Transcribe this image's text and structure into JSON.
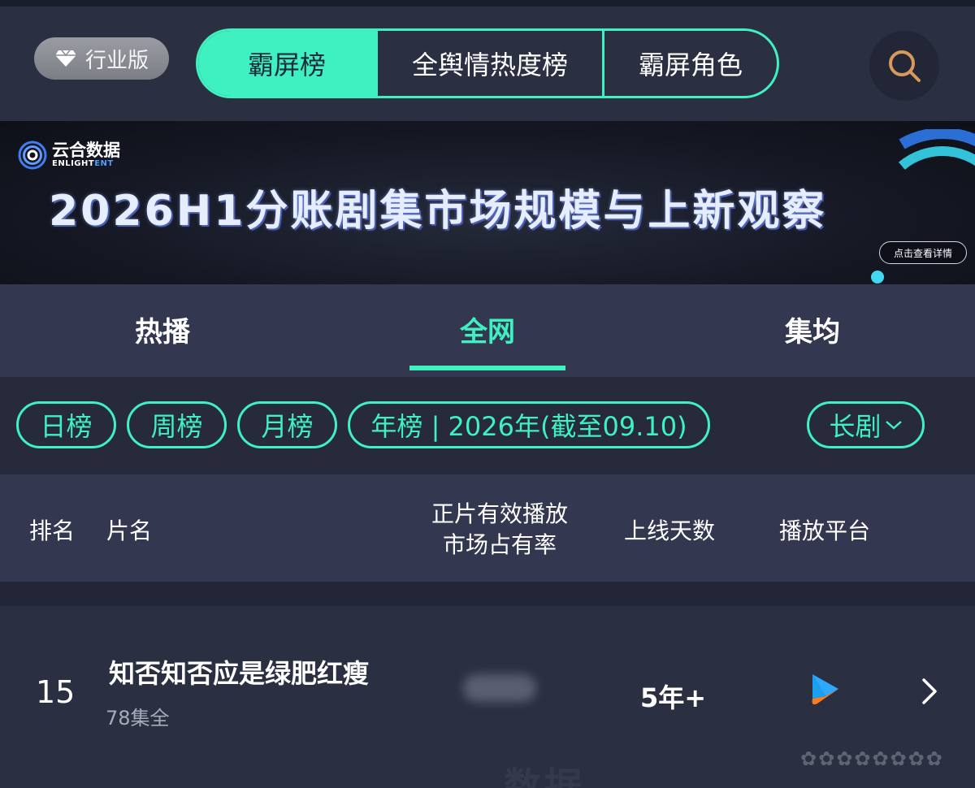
{
  "header": {
    "edition_badge": "行业版",
    "tabs": [
      {
        "label": "霸屏榜",
        "active": true
      },
      {
        "label": "全舆情热度榜",
        "active": false
      },
      {
        "label": "霸屏角色",
        "active": false
      }
    ],
    "search_icon": "search-icon"
  },
  "banner": {
    "logo_cn": "云合数据",
    "logo_en_part1": "ENLIGHT",
    "logo_en_part2": "ENT",
    "title": "2026H1分账剧集市场规模与上新观察",
    "detail_button": "点击查看详情"
  },
  "category_tabs": [
    {
      "label": "热播",
      "active": false
    },
    {
      "label": "全网",
      "active": true
    },
    {
      "label": "集均",
      "active": false
    }
  ],
  "filters": {
    "pills": [
      "日榜",
      "周榜",
      "月榜",
      "年榜 | 2026年(截至09.10)"
    ],
    "type_select": "长剧"
  },
  "table": {
    "headers": {
      "rank": "排名",
      "name": "片名",
      "share_line1": "正片有效播放",
      "share_line2": "市场占有率",
      "days": "上线天数",
      "platform": "播放平台"
    },
    "rows": [
      {
        "rank": "15",
        "title": "知否知否应是绿肥红瘦",
        "episodes": "78集全",
        "days_online": "5年+",
        "platform_icon": "youku-icon"
      }
    ]
  },
  "colors": {
    "accent": "#3ff0c0",
    "background": "#262a3b",
    "panel": "#33374f"
  }
}
